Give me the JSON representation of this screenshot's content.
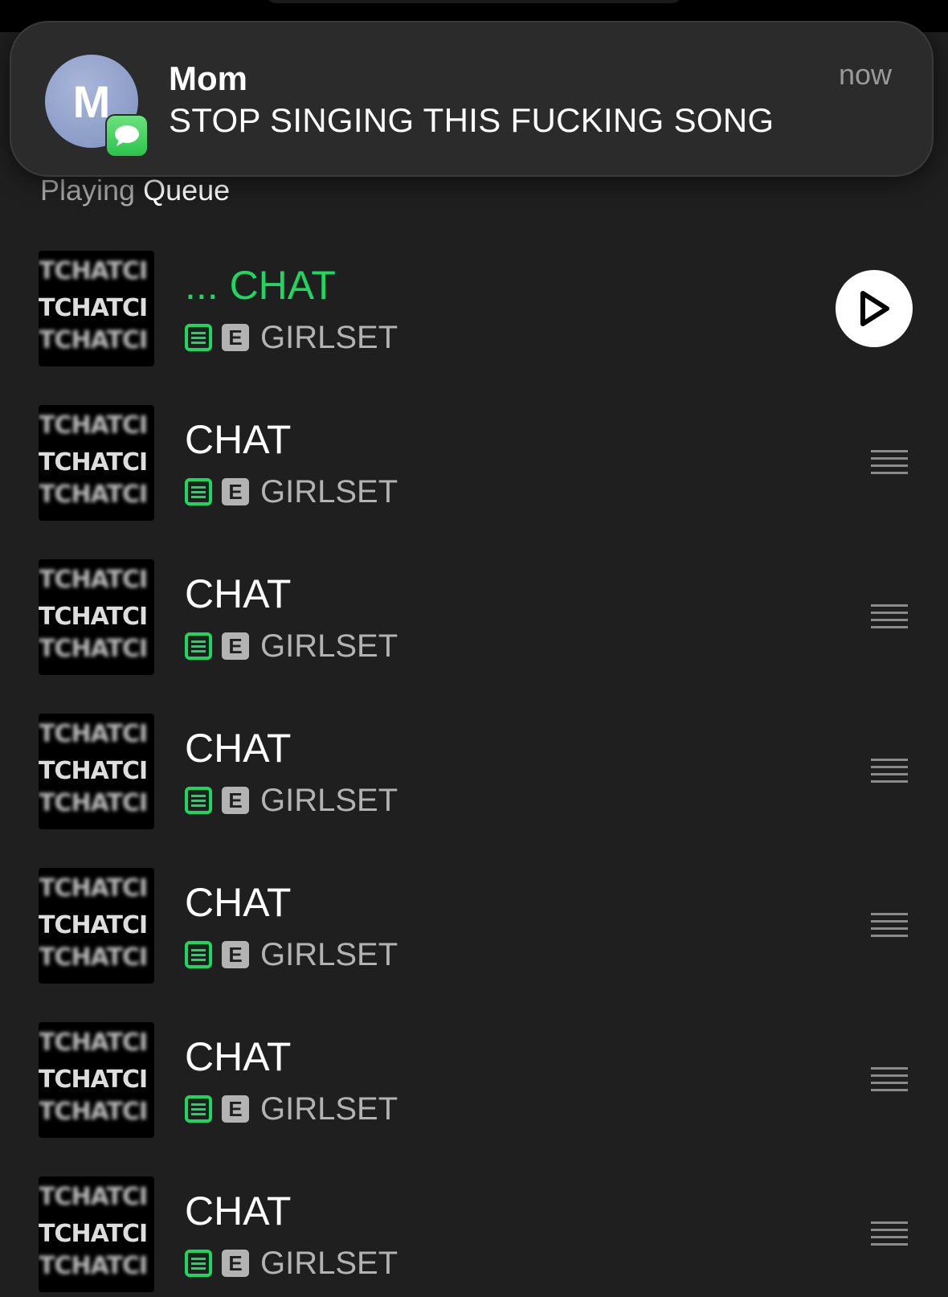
{
  "notification": {
    "avatar_letter": "M",
    "sender": "Mom",
    "message": "STOP SINGING THIS FUCKING SONG",
    "time": "now",
    "app_icon": "messages-icon",
    "badge_color": "#34c759"
  },
  "queue_header": {
    "label_prefix": "Playing",
    "label_main": "Queue"
  },
  "colors": {
    "accent": "#1ed760",
    "background": "#1f1f1f"
  },
  "art_lines": [
    "TCHATCI",
    "TCHATCI",
    "TCHATCI"
  ],
  "tracks": [
    {
      "title": "... CHAT",
      "explicit": "E",
      "artist": "GIRLSET",
      "now_playing": true
    },
    {
      "title": "CHAT",
      "explicit": "E",
      "artist": "GIRLSET",
      "now_playing": false
    },
    {
      "title": "CHAT",
      "explicit": "E",
      "artist": "GIRLSET",
      "now_playing": false
    },
    {
      "title": "CHAT",
      "explicit": "E",
      "artist": "GIRLSET",
      "now_playing": false
    },
    {
      "title": "CHAT",
      "explicit": "E",
      "artist": "GIRLSET",
      "now_playing": false
    },
    {
      "title": "CHAT",
      "explicit": "E",
      "artist": "GIRLSET",
      "now_playing": false
    },
    {
      "title": "CHAT",
      "explicit": "E",
      "artist": "GIRLSET",
      "now_playing": false
    }
  ]
}
